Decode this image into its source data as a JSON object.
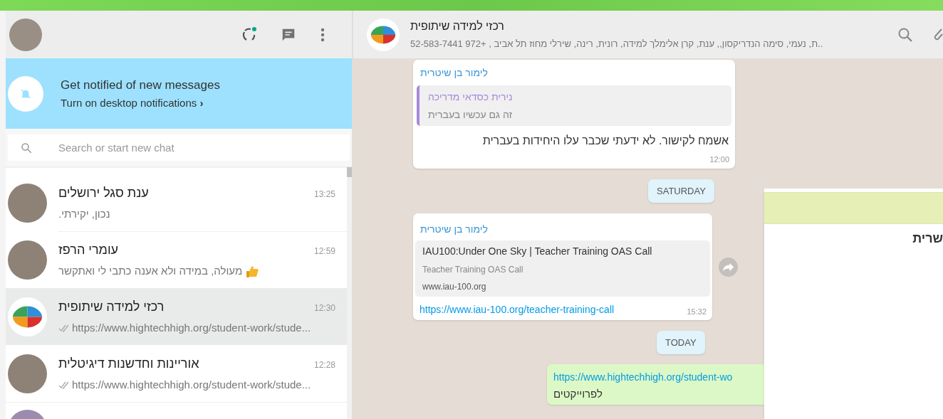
{
  "sidebar": {
    "notification": {
      "title": "Get notified of new messages",
      "link": "Turn on desktop notifications",
      "chevron": "›"
    },
    "search": {
      "placeholder": "Search or start new chat"
    },
    "chats": [
      {
        "name": "ענת סגל ירושלים",
        "time": "13:25",
        "preview": "נכון, יקירתי.",
        "kind": "plain",
        "group_avatar": false,
        "selected": false
      },
      {
        "name": "עומרי הרפז",
        "time": "12:59",
        "preview": "מעולה, במידה ולא אענה כתבי לי ואתקשר",
        "kind": "emoji",
        "group_avatar": false,
        "selected": false
      },
      {
        "name": "רכזי למידה שיתופית",
        "time": "12:30",
        "preview": "https://www.hightechhigh.org/student-work/stude...",
        "kind": "sent",
        "group_avatar": true,
        "selected": true
      },
      {
        "name": "אוריינות וחדשנות דיגיטלית",
        "time": "12:28",
        "preview": "https://www.hightechhigh.org/student-work/stude...",
        "kind": "sent",
        "group_avatar": false,
        "selected": false
      }
    ]
  },
  "conversation": {
    "header": {
      "title": "רכזי למידה שיתופית",
      "subtitle": "..ת, נעמי, סימה הנדריקסון,, ענת, קרן אלימלך למידה, רונית, רינה, שירלי מחוז תל אביב , +972 52-583-7441"
    },
    "messages": [
      {
        "kind": "quote",
        "sender": "לימור בן שיטרית",
        "quote_author": "נירית כסדאי מדריכה",
        "quote_text": "זה גם עכשיו בעברית",
        "text": "אשמח לקישור. לא ידעתי שכבר עלו היחידות בעברית",
        "time": "12:00"
      },
      {
        "kind": "date",
        "text": "SATURDAY"
      },
      {
        "kind": "link",
        "sender": "לימור בן שיטרית",
        "preview_title": "IAU100:Under One Sky | Teacher Training OAS Call",
        "preview_description": "Teacher Training OAS Call",
        "preview_domain": "www.iau-100.org",
        "text": "https://www.iau-100.org/teacher-training-call",
        "time": "15:32"
      },
      {
        "kind": "date",
        "text": "TODAY"
      },
      {
        "kind": "outgoing",
        "link": "https://www.hightechhigh.org/student-wo",
        "text": "לפרוייקטים"
      }
    ]
  },
  "overlay_window": {
    "text": "שרית"
  }
}
